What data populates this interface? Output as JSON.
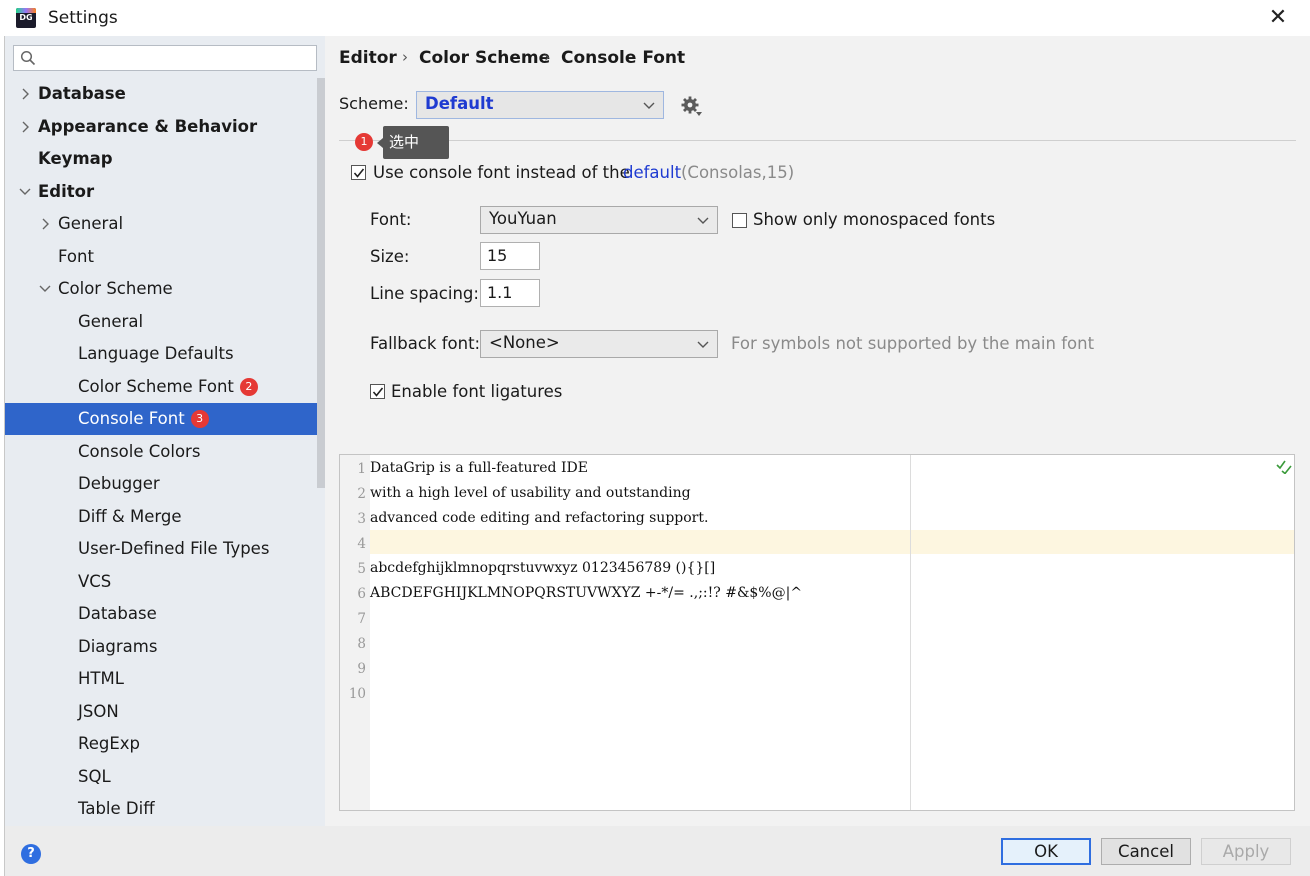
{
  "window": {
    "title": "Settings",
    "app_icon_text": "DG"
  },
  "search": {
    "placeholder": ""
  },
  "tree": [
    {
      "label": "Database",
      "level": 0,
      "expander": "collapsed",
      "bold": true
    },
    {
      "label": "Appearance & Behavior",
      "level": 0,
      "expander": "collapsed",
      "bold": true
    },
    {
      "label": "Keymap",
      "level": 0,
      "expander": "none",
      "bold": true
    },
    {
      "label": "Editor",
      "level": 0,
      "expander": "expanded",
      "bold": true
    },
    {
      "label": "General",
      "level": 1,
      "expander": "collapsed"
    },
    {
      "label": "Font",
      "level": 1,
      "expander": "none"
    },
    {
      "label": "Color Scheme",
      "level": 1,
      "expander": "expanded"
    },
    {
      "label": "General",
      "level": 2
    },
    {
      "label": "Language Defaults",
      "level": 2
    },
    {
      "label": "Color Scheme Font",
      "level": 2,
      "badge": "2"
    },
    {
      "label": "Console Font",
      "level": 2,
      "badge": "3",
      "selected": true
    },
    {
      "label": "Console Colors",
      "level": 2
    },
    {
      "label": "Debugger",
      "level": 2
    },
    {
      "label": "Diff & Merge",
      "level": 2
    },
    {
      "label": "User-Defined File Types",
      "level": 2
    },
    {
      "label": "VCS",
      "level": 2
    },
    {
      "label": "Database",
      "level": 2
    },
    {
      "label": "Diagrams",
      "level": 2
    },
    {
      "label": "HTML",
      "level": 2
    },
    {
      "label": "JSON",
      "level": 2
    },
    {
      "label": "RegExp",
      "level": 2
    },
    {
      "label": "SQL",
      "level": 2
    },
    {
      "label": "Table Diff",
      "level": 2
    }
  ],
  "breadcrumb": [
    "Editor",
    "Color Scheme",
    "Console Font"
  ],
  "breadcrumb_separator": "›",
  "scheme": {
    "label": "Scheme:",
    "value": "Default"
  },
  "annotation": {
    "badge": "1",
    "tooltip": "选中"
  },
  "use_console_font": {
    "checked": true,
    "label": "Use console font instead of the",
    "link": "default",
    "hint": "(Consolas,15)"
  },
  "font": {
    "label": "Font:",
    "value": "YouYuan"
  },
  "monospaced": {
    "checked": false,
    "label": "Show only monospaced fonts"
  },
  "size": {
    "label": "Size:",
    "value": "15"
  },
  "line_spacing": {
    "label": "Line spacing:",
    "value": "1.1"
  },
  "fallback": {
    "label": "Fallback font:",
    "value": "<None>",
    "hint": "For symbols not supported by the main font"
  },
  "ligatures": {
    "checked": true,
    "label": "Enable font ligatures"
  },
  "preview": {
    "lines": [
      "DataGrip is a full-featured IDE",
      "with a high level of usability and outstanding",
      "advanced code editing and refactoring support.",
      "",
      "abcdefghijklmnopqrstuvwxyz 0123456789 (){}[]",
      "ABCDEFGHIJKLMNOPQRSTUVWXYZ +-*/= .,;:!? #&$%@|^",
      "",
      "",
      "",
      ""
    ],
    "line_numbers": [
      "1",
      "2",
      "3",
      "4",
      "5",
      "6",
      "7",
      "8",
      "9",
      "10"
    ],
    "caret_line": 4
  },
  "buttons": {
    "help": "?",
    "ok": "OK",
    "cancel": "Cancel",
    "apply": "Apply"
  },
  "colors": {
    "selection": "#2f65ca",
    "link": "#1f3bd1",
    "badge": "#e53935",
    "caret_line": "#fdf6e0"
  }
}
